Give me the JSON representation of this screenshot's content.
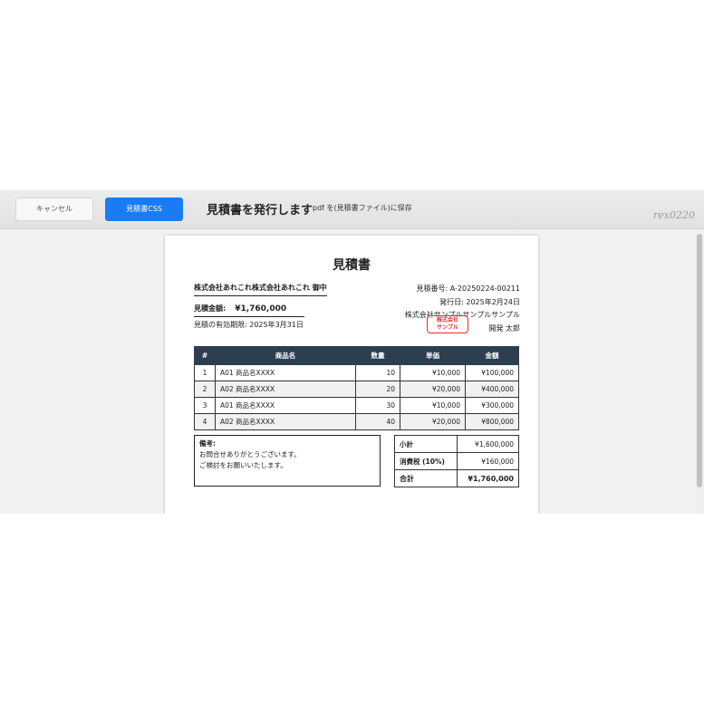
{
  "toolbar": {
    "cancel_label": "キャンセル",
    "css_label": "見積書CSS",
    "title": "見積書を発行します",
    "subtitle": "pdf を(見積書ファイル)に保存",
    "watermark": "rex0220"
  },
  "document": {
    "title": "見積書",
    "recipient": "株式会社あれこれ株式会社あれこれ 御中",
    "amount_label": "見積金額:",
    "amount_value": "¥1,760,000",
    "validity": "見積の有効期限: 2025年3月31日",
    "quote_no": "見積番号: A-20250224-00211",
    "issue_date": "発行日: 2025年2月24日",
    "company": "株式会社サンプルサンプルサンプル",
    "person": "開発 太郎",
    "stamp_line1": "株式会社",
    "stamp_line2": "サンプル"
  },
  "table": {
    "headers": [
      "#",
      "商品名",
      "数量",
      "単価",
      "金額"
    ],
    "rows": [
      [
        "1",
        "A01 商品名XXXX",
        "10",
        "¥10,000",
        "¥100,000"
      ],
      [
        "2",
        "A02 商品名XXXX",
        "20",
        "¥20,000",
        "¥400,000"
      ],
      [
        "3",
        "A01 商品名XXXX",
        "30",
        "¥10,000",
        "¥300,000"
      ],
      [
        "4",
        "A02 商品名XXXX",
        "40",
        "¥20,000",
        "¥800,000"
      ]
    ]
  },
  "notes": {
    "title": "備考:",
    "line1": "お問合せありがとうございます。",
    "line2": "ご検討をお願いいたします。"
  },
  "totals": {
    "subtotal_label": "小計",
    "subtotal_value": "¥1,600,000",
    "tax_label": "消費税 (10%)",
    "tax_value": "¥160,000",
    "total_label": "合計",
    "total_value": "¥1,760,000"
  },
  "colors": {
    "accent": "#1a7cf5",
    "table_header": "#2d3e50",
    "stamp": "#e0302a"
  }
}
